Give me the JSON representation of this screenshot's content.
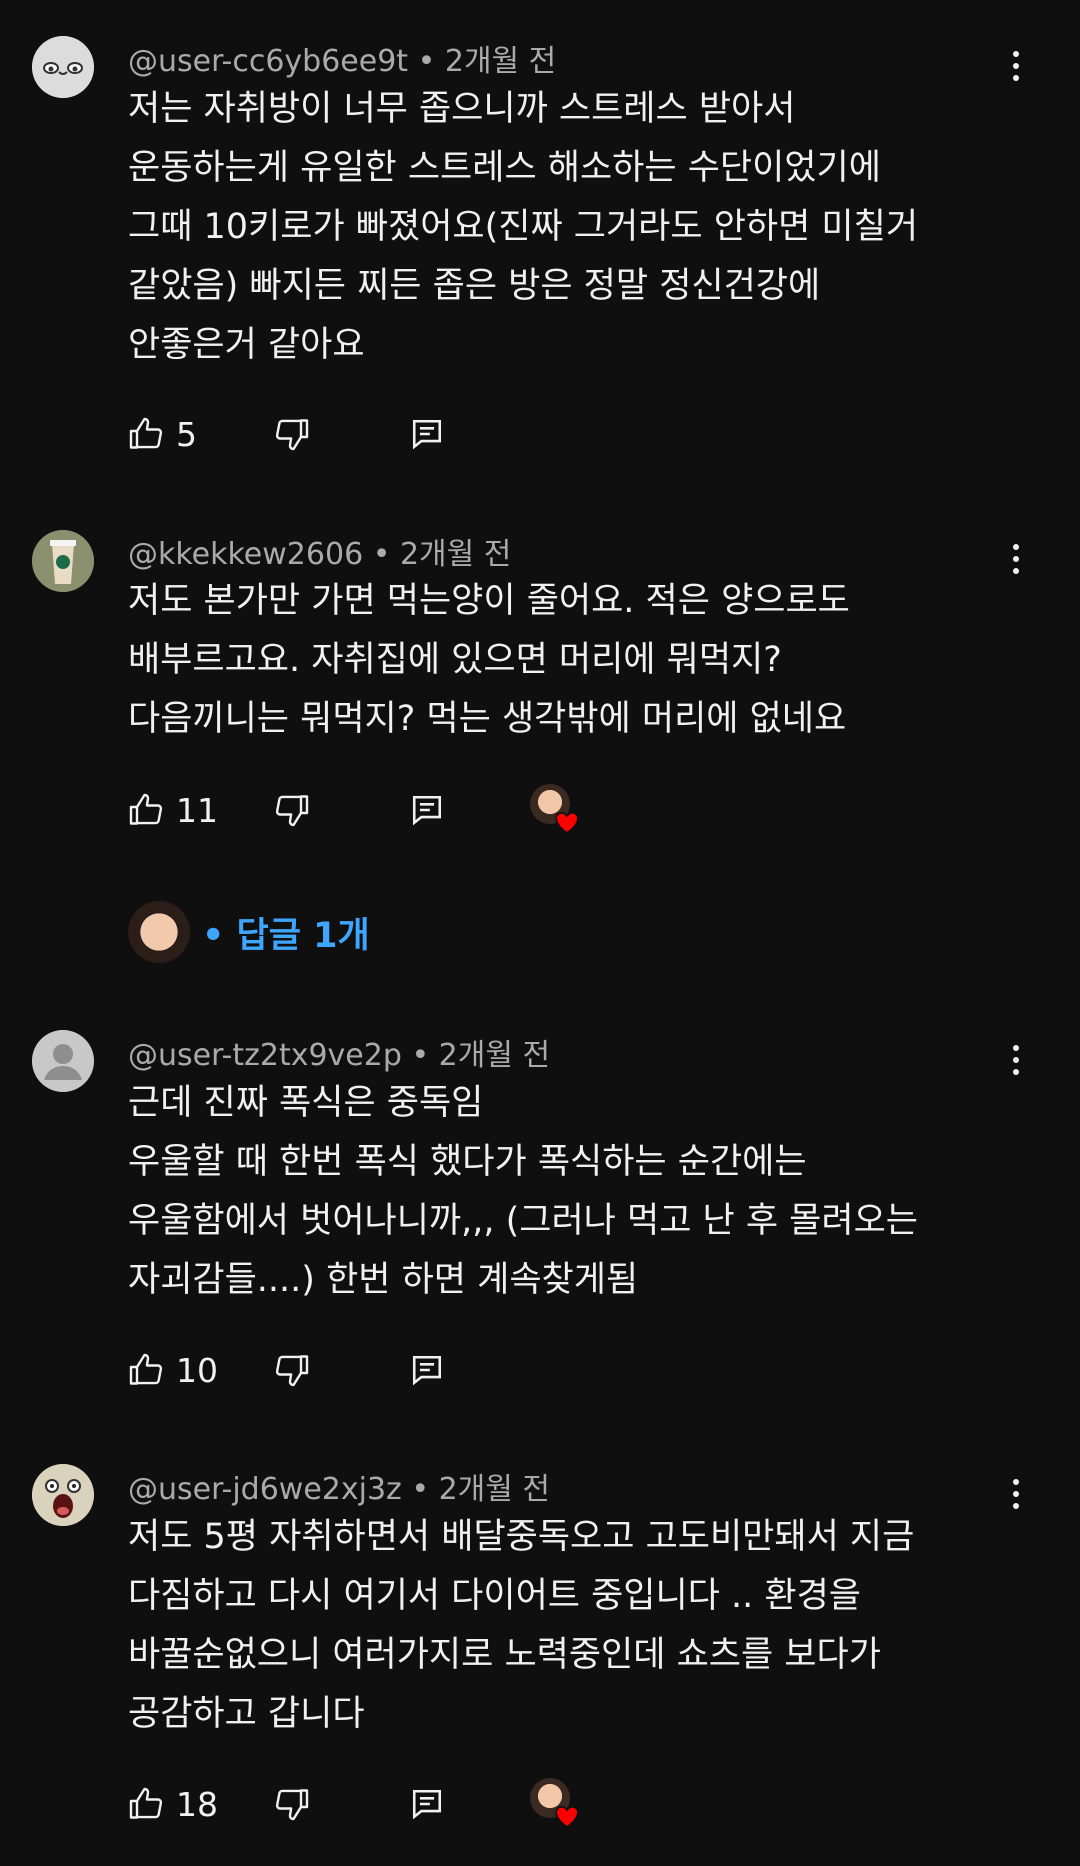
{
  "comments": [
    {
      "handle": "@user-cc6yb6ee9t",
      "time": "2개월 전",
      "avatar_icon": "cartoon-face-avatar",
      "lines": [
        "저는 자취방이 너무 좁으니까 스트레스 받아서",
        "운동하는게 유일한 스트레스 해소하는 수단이었기에",
        "그때 10키로가 빠졌어요(진짜 그거라도 안하면 미칠거",
        "같았음) 빠지든 찌든 좁은 방은 정말 정신건강에",
        "안좋은거 같아요"
      ],
      "likes": "5"
    },
    {
      "handle": "@kkekkew2606",
      "time": "2개월 전",
      "avatar_icon": "coffee-cup-avatar",
      "lines": [
        "저도 본가만 가면 먹는양이 줄어요. 적은 양으로도",
        "배부르고요. 자취집에 있으면 머리에 뭐먹지?",
        "다음끼니는 뭐먹지? 먹는 생각밖에 머리에 없네요"
      ],
      "likes": "11",
      "creator_hearted": true
    },
    {
      "handle": "@user-tz2tx9ve2p",
      "time": "2개월 전",
      "avatar_icon": "default-person-avatar",
      "lines": [
        "근데 진짜 폭식은 중독임",
        "우울할 때 한번 폭식 했다가 폭식하는 순간에는",
        "우울함에서 벗어나니까,,, (그러나 먹고 난 후 몰려오는",
        "자괴감들....) 한번 하면 계속찾게됨"
      ],
      "likes": "10"
    },
    {
      "handle": "@user-jd6we2xj3z",
      "time": "2개월 전",
      "avatar_icon": "screaming-face-avatar",
      "lines": [
        "저도 5평 자취하면서 배달중독오고 고도비만돼서 지금",
        "다짐하고 다시 여기서 다이어트 중입니다 .. 환경을",
        "바꿀순없으니 여러가지로 노력중인데 쇼츠를 보다가",
        "공감하고 갑니다"
      ],
      "likes": "18",
      "creator_hearted": true
    }
  ],
  "replies": {
    "label": "• 답글 1개"
  },
  "colors": {
    "background": "#0f0f0f",
    "text": "#f1f1f1",
    "meta": "#aaaaaa",
    "link": "#3ea6ff",
    "heart": "#ff0000"
  }
}
